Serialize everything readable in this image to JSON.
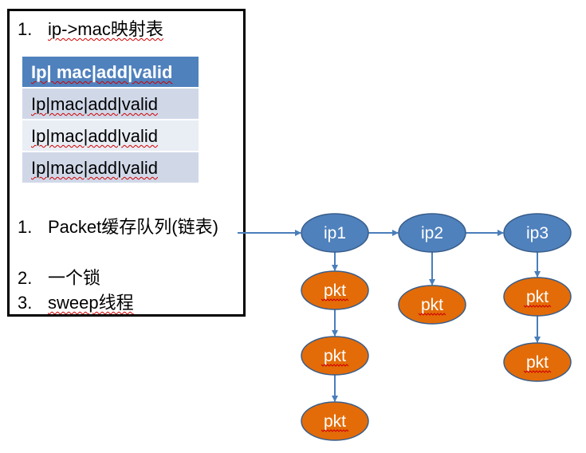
{
  "left_panel": {
    "item1_number": "1.",
    "item1_text": "ip->mac映射表",
    "table_header": "Ip| mac|add|valid",
    "table_rows": [
      "Ip|mac|add|valid",
      "Ip|mac|add|valid",
      "Ip|mac|add|valid"
    ],
    "item2_number": "1.",
    "item2_text": "Packet缓存队列(链表)",
    "item3_number": "2.",
    "item3_text": "一个锁",
    "item4_number": "3.",
    "item4_text": "sweep线程"
  },
  "graph": {
    "ip_nodes": [
      "ip1",
      "ip2",
      "ip3"
    ],
    "pkt_label": "pkt",
    "packets_per_ip": [
      3,
      1,
      2
    ]
  },
  "colors": {
    "ip_node_fill": "#4f81bd",
    "pkt_node_fill": "#e36c09",
    "arrow": "#4a7ebb",
    "table_header": "#4f81bd",
    "table_row_odd": "#d0d8e8",
    "table_row_even": "#e9edf4"
  }
}
